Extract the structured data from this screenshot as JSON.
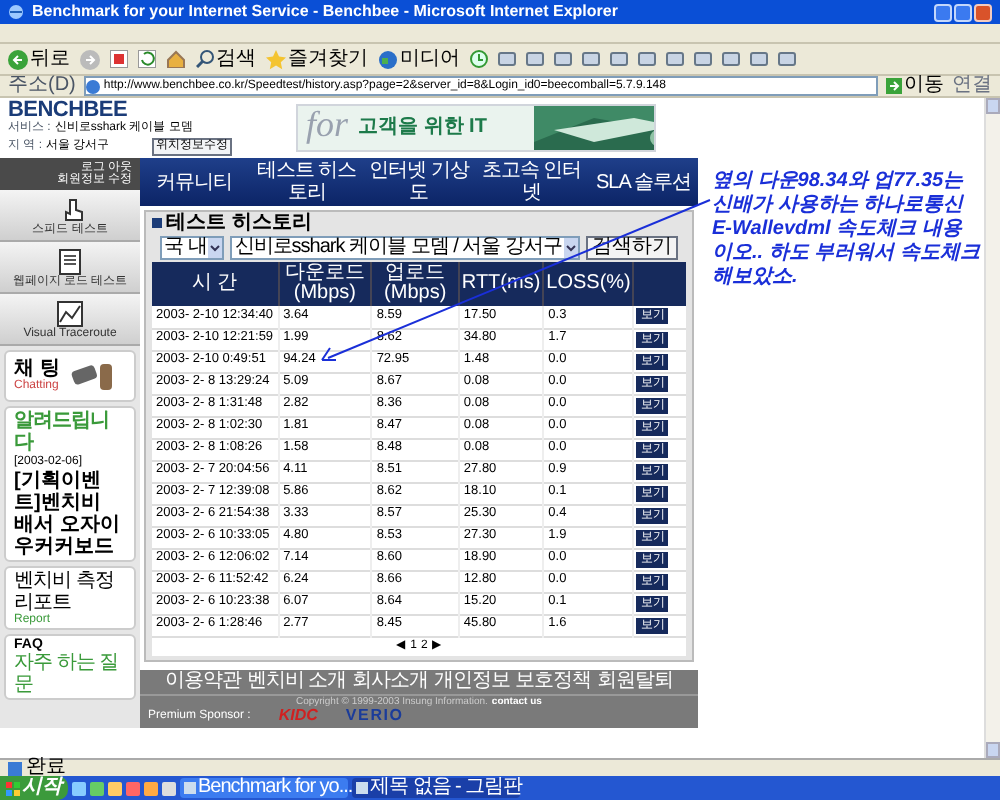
{
  "window": {
    "title": "Benchmark for your Internet Service - Benchbee - Microsoft Internet Explorer"
  },
  "toolbar": {
    "labels": [
      "뒤로",
      "검색",
      "즐겨찾기",
      "미디어"
    ]
  },
  "address_bar": {
    "label": "주소(D)",
    "url": "http://www.benchbee.co.kr/Speedtest/history.asp?page=2&server_id=8&Login_id0=beecomball=5.7.9.148",
    "go": "이동",
    "links": "연결"
  },
  "site": {
    "logo": "BENCHBEE",
    "service_label": "서비스 :",
    "service": "신비로sshark 케이블 모뎀",
    "region_label": "지 역 :",
    "region": "서울 강서구",
    "edit_button": "위치정보수정",
    "banner": {
      "faded": "for",
      "slogan": "고객을 위한 IT"
    },
    "account_links": [
      "로그 아웃",
      "회원정보 수정"
    ],
    "nav": [
      "커뮤니티",
      "테스트 히스토리",
      "인터넷 기상도",
      "초고속 인터넷",
      "SLA 솔루션"
    ],
    "sidebar": {
      "tools": [
        "스피드 테스트",
        "웹페이지 로드 테스트",
        "Visual Traceroute"
      ],
      "chat": {
        "label": "채 팅",
        "sub": "Chatting"
      },
      "notice": {
        "title": "알려드립니다",
        "date": "[2003-02-06]",
        "text": "[기획이벤트]벤치비 배서 오자이 우커커보드"
      },
      "report": {
        "title": "벤치비 측정 리포트",
        "sub": "Report"
      },
      "faq": {
        "title": "FAQ",
        "sub": "자주 하는 질문"
      }
    },
    "history": {
      "title": "테스트 히스토리",
      "scope": "국 내",
      "line": "신비로sshark 케이블 모뎀 / 서울 강서구",
      "search_button": "검색하기",
      "columns": [
        "시 간",
        "다운로드(Mbps)",
        "업로드(Mbps)",
        "RTT(ms)",
        "LOSS(%)"
      ],
      "rows": [
        {
          "time": "2003- 2-10 12:34:40",
          "download": "3.64",
          "upload": "8.59",
          "rtt": "17.50",
          "loss": "0.3",
          "button": "보기"
        },
        {
          "time": "2003- 2-10 12:21:59",
          "download": "1.99",
          "upload": "8.62",
          "rtt": "34.80",
          "loss": "1.7",
          "button": "보기"
        },
        {
          "time": "2003- 2-10 0:49:51",
          "download": "94.24",
          "upload": "72.95",
          "rtt": "1.48",
          "loss": "0.0",
          "button": "보기"
        },
        {
          "time": "2003- 2- 8 13:29:24",
          "download": "5.09",
          "upload": "8.67",
          "rtt": "0.08",
          "loss": "0.0",
          "button": "보기"
        },
        {
          "time": "2003- 2- 8 1:31:48",
          "download": "2.82",
          "upload": "8.36",
          "rtt": "0.08",
          "loss": "0.0",
          "button": "보기"
        },
        {
          "time": "2003- 2- 8 1:02:30",
          "download": "1.81",
          "upload": "8.47",
          "rtt": "0.08",
          "loss": "0.0",
          "button": "보기"
        },
        {
          "time": "2003- 2- 8 1:08:26",
          "download": "1.58",
          "upload": "8.48",
          "rtt": "0.08",
          "loss": "0.0",
          "button": "보기"
        },
        {
          "time": "2003- 2- 7 20:04:56",
          "download": "4.11",
          "upload": "8.51",
          "rtt": "27.80",
          "loss": "0.9",
          "button": "보기"
        },
        {
          "time": "2003- 2- 7 12:39:08",
          "download": "5.86",
          "upload": "8.62",
          "rtt": "18.10",
          "loss": "0.1",
          "button": "보기"
        },
        {
          "time": "2003- 2- 6 21:54:38",
          "download": "3.33",
          "upload": "8.57",
          "rtt": "25.30",
          "loss": "0.4",
          "button": "보기"
        },
        {
          "time": "2003- 2- 6 10:33:05",
          "download": "4.80",
          "upload": "8.53",
          "rtt": "27.30",
          "loss": "1.9",
          "button": "보기"
        },
        {
          "time": "2003- 2- 6 12:06:02",
          "download": "7.14",
          "upload": "8.60",
          "rtt": "18.90",
          "loss": "0.0",
          "button": "보기"
        },
        {
          "time": "2003- 2- 6 11:52:42",
          "download": "6.24",
          "upload": "8.66",
          "rtt": "12.80",
          "loss": "0.0",
          "button": "보기"
        },
        {
          "time": "2003- 2- 6 10:23:38",
          "download": "6.07",
          "upload": "8.64",
          "rtt": "15.20",
          "loss": "0.1",
          "button": "보기"
        },
        {
          "time": "2003- 2- 6 1:28:46",
          "download": "2.77",
          "upload": "8.45",
          "rtt": "45.80",
          "loss": "1.6",
          "button": "보기"
        }
      ],
      "pager": [
        "◀",
        "1",
        "2",
        "▶"
      ]
    },
    "footer": {
      "links": [
        "이용약관",
        "벤치비 소개",
        "회사소개",
        "개인정보 보호정책",
        "회원탈퇴"
      ],
      "copyright": "Copyright © 1999-2003 Insung Information.",
      "contact": "contact us",
      "sponsor_label": "Premium Sponsor :",
      "sponsors": [
        "KIDC",
        "VERIO"
      ]
    }
  },
  "annotation": "옆의 다운98.34와 업77.35는 신배가 사용하는 하나로통신 E-Wallevdml 속도체크 내용이오.. 하도 부러워서 속도체크 해보았소.",
  "status_bar": {
    "text": "완료"
  },
  "taskbar": {
    "start": "시작",
    "tasks": [
      {
        "label": "Benchmark for yo...",
        "selected": false
      },
      {
        "label": "제목 없음 - 그림판",
        "selected": true
      }
    ]
  }
}
